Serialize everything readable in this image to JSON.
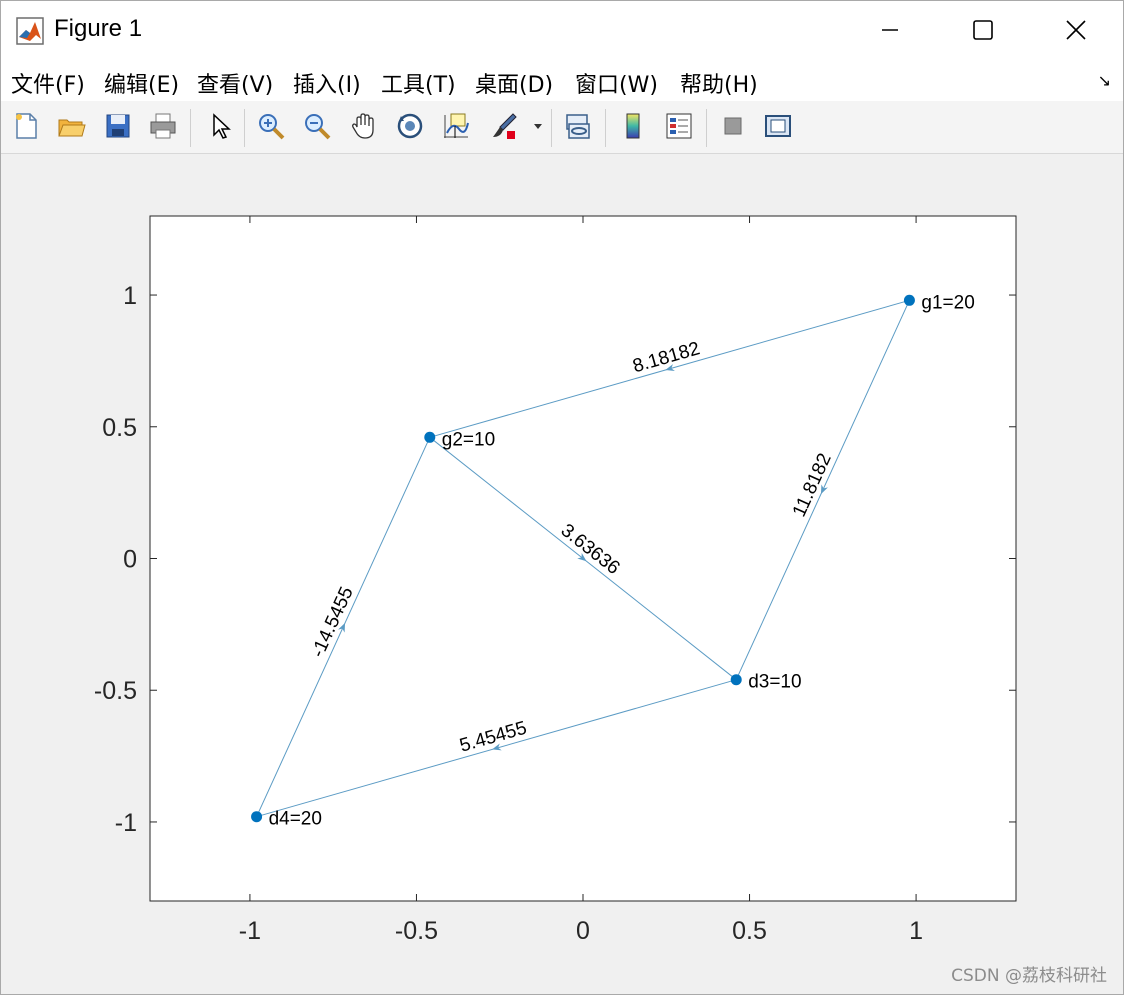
{
  "window": {
    "title": "Figure 1"
  },
  "menu": {
    "items": [
      "文件(F)",
      "编辑(E)",
      "查看(V)",
      "插入(I)",
      "工具(T)",
      "桌面(D)",
      "窗口(W)",
      "帮助(H)"
    ]
  },
  "toolbar": {
    "buttons": [
      "new-figure-icon",
      "open-file-icon",
      "save-icon",
      "print-icon",
      "pointer-icon",
      "zoom-in-icon",
      "zoom-out-icon",
      "pan-hand-icon",
      "rotate-3d-icon",
      "data-cursor-icon",
      "brush-icon",
      "link-plot-icon",
      "colorbar-icon",
      "legend-icon",
      "hide-plot-tools-icon",
      "show-plot-tools-icon"
    ]
  },
  "watermark": "CSDN @荔枝科研社",
  "colors": {
    "edge": "#5b9bc4",
    "node": "#0072bd"
  },
  "chart_data": {
    "type": "scatter",
    "xlim": [
      -1.3,
      1.3
    ],
    "ylim": [
      -1.3,
      1.3
    ],
    "xticks": [
      "-1",
      "-0.5",
      "0",
      "0.5",
      "1"
    ],
    "yticks": [
      "1",
      "0.5",
      "0",
      "-0.5",
      "-1"
    ],
    "xtick_values": [
      -1,
      -0.5,
      0,
      0.5,
      1
    ],
    "ytick_values": [
      1,
      0.5,
      0,
      -0.5,
      -1
    ],
    "grid": false,
    "nodes": [
      {
        "id": "g1",
        "label": "g1=20",
        "x": 0.98,
        "y": 0.98
      },
      {
        "id": "g2",
        "label": "g2=10",
        "x": -0.46,
        "y": 0.46
      },
      {
        "id": "d3",
        "label": "d3=10",
        "x": 0.46,
        "y": -0.46
      },
      {
        "id": "d4",
        "label": "d4=20",
        "x": -0.98,
        "y": -0.98
      }
    ],
    "edges": [
      {
        "from": "g1",
        "to": "g2",
        "label": "8.18182"
      },
      {
        "from": "g1",
        "to": "d3",
        "label": "11.8182"
      },
      {
        "from": "g2",
        "to": "d3",
        "label": "3.63636"
      },
      {
        "from": "d3",
        "to": "d4",
        "label": "5.45455"
      },
      {
        "from": "d4",
        "to": "g2",
        "label": "-14.5455"
      }
    ]
  }
}
